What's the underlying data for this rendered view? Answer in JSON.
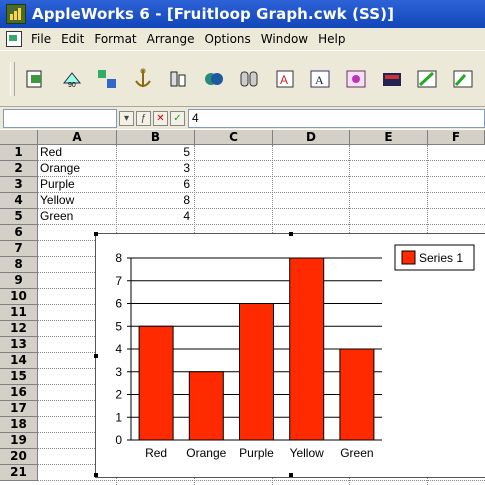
{
  "window": {
    "title": "AppleWorks 6 - [Fruitloop Graph.cwk (SS)]"
  },
  "menu": [
    "File",
    "Edit",
    "Format",
    "Arrange",
    "Options",
    "Window",
    "Help"
  ],
  "toolbar": {
    "icons": [
      "insert-object-icon",
      "rotate-icon",
      "group-icon",
      "anchor-icon",
      "align-icon",
      "fill-icon",
      "stroke-icon",
      "text-icon",
      "text-box-icon",
      "image-icon",
      "palette-icon",
      "draw-icon",
      "more-icon"
    ]
  },
  "entry_bar": {
    "cell_ref": "",
    "value": "4"
  },
  "columns": [
    "A",
    "B",
    "C",
    "D",
    "E",
    "F"
  ],
  "rows": [
    "1",
    "2",
    "3",
    "4",
    "5",
    "6",
    "7",
    "8",
    "9",
    "10",
    "11",
    "12",
    "13",
    "14",
    "15",
    "16",
    "17",
    "18",
    "19",
    "20",
    "21"
  ],
  "cells": [
    {
      "label": "Red",
      "value": "5"
    },
    {
      "label": "Orange",
      "value": "3"
    },
    {
      "label": "Purple",
      "value": "6"
    },
    {
      "label": "Yellow",
      "value": "8"
    },
    {
      "label": "Green",
      "value": "4"
    }
  ],
  "chart_data": {
    "type": "bar",
    "categories": [
      "Red",
      "Orange",
      "Purple",
      "Yellow",
      "Green"
    ],
    "series": [
      {
        "name": "Series 1",
        "values": [
          5,
          3,
          6,
          8,
          4
        ],
        "color": "#ff2a00"
      }
    ],
    "ylim": [
      0,
      8
    ],
    "yticks": [
      "0",
      "1",
      "2",
      "3",
      "4",
      "5",
      "6",
      "7",
      "8"
    ],
    "grid": true,
    "legend": "top-right",
    "title": "",
    "xlabel": "",
    "ylabel": ""
  },
  "colors": {
    "titlebar": "#1c52c8",
    "bar": "#ff2a00"
  }
}
